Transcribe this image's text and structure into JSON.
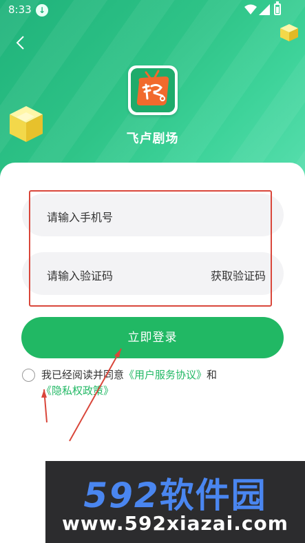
{
  "status_bar": {
    "time": "8:33"
  },
  "app": {
    "name": "飞卢剧场"
  },
  "form": {
    "phone_placeholder": "请输入手机号",
    "code_placeholder": "请输入验证码",
    "get_code_label": "获取验证码",
    "login_label": "立即登录"
  },
  "agreement": {
    "prefix": "我已经阅读并同意",
    "user_agreement": "《用户服务协议》",
    "and": "和",
    "privacy_policy": "《隐私权政策》"
  },
  "watermark": {
    "brand_num": "592",
    "brand_cn": "软件园",
    "url": "www.592xiazai.com"
  },
  "colors": {
    "accent": "#21b864",
    "header": "#2fc488",
    "annotation": "#d9463a"
  },
  "icons": [
    "download-icon",
    "wifi-icon",
    "signal-icon",
    "battery-icon",
    "back-icon",
    "cube-icon",
    "app-logo"
  ]
}
